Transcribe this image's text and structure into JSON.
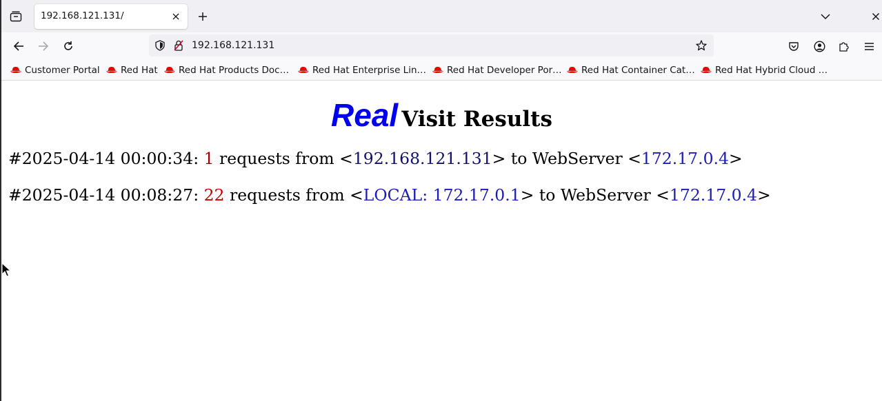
{
  "browser": {
    "tab": {
      "title": "192.168.121.131/"
    },
    "url": "192.168.121.131",
    "bookmarks": [
      {
        "label": "Customer Portal",
        "icon": "redhat-icon"
      },
      {
        "label": "Red Hat",
        "icon": "redhat-icon"
      },
      {
        "label": "Red Hat Products Doc…",
        "icon": "redhat-icon"
      },
      {
        "label": "Red Hat Enterprise Lin…",
        "icon": "redhat-icon"
      },
      {
        "label": "Red Hat Developer Por…",
        "icon": "redhat-icon"
      },
      {
        "label": "Red Hat Container Cat…",
        "icon": "redhat-icon"
      },
      {
        "label": "Red Hat Hybrid Cloud …",
        "icon": "redhat-icon"
      }
    ]
  },
  "page": {
    "heading": {
      "emphasis": "Real",
      "rest": "Visit Results"
    },
    "visits": [
      {
        "timestamp": "#2025-04-14 00:00:34:",
        "count": "1",
        "middle": "requests from <",
        "source": "192.168.121.131",
        "to_text": "> to WebServer <",
        "server": "172.17.0.4",
        "end": ">"
      },
      {
        "timestamp": "#2025-04-14 00:08:27:",
        "count": "22",
        "middle": "requests from <",
        "source": "LOCAL: 172.17.0.1",
        "to_text": "> to WebServer <",
        "server": "172.17.0.4",
        "end": ">"
      }
    ]
  },
  "colors": {
    "heading_emphasis": "#0000ee",
    "count_1": "#a00000",
    "count_2": "#cc0000",
    "ip_1": "#12126e",
    "ip_2": "#1c1cb8"
  }
}
